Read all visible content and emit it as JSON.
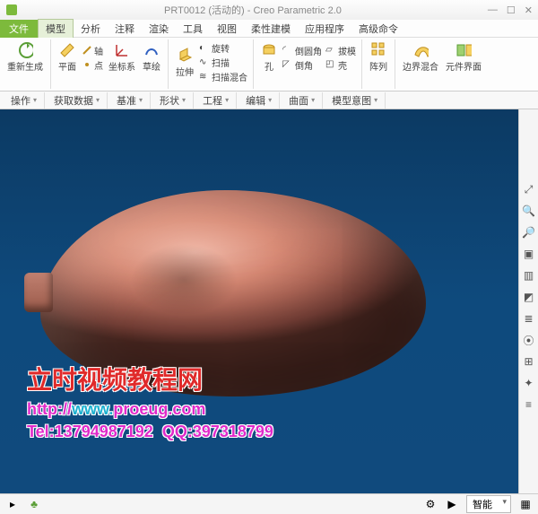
{
  "titlebar": {
    "title": "PRT0012 (活动的) - Creo Parametric 2.0"
  },
  "menubar": {
    "file": "文件",
    "items": [
      "模型",
      "分析",
      "注释",
      "渲染",
      "工具",
      "视图",
      "柔性建模",
      "应用程序",
      "高级命令"
    ],
    "active_index": 0
  },
  "ribbon": {
    "groups": [
      {
        "buttons": [
          {
            "label": "重新生成",
            "icon": "regen"
          }
        ],
        "small": [],
        "label": ""
      },
      {
        "buttons": [
          {
            "label": "平面",
            "icon": "plane"
          },
          {
            "label": "坐标系",
            "icon": "csys"
          },
          {
            "label": "草绘",
            "icon": "sketch"
          }
        ],
        "small": [
          {
            "label": "轴",
            "icon": "axis"
          },
          {
            "label": "点",
            "icon": "point"
          }
        ],
        "label": ""
      },
      {
        "buttons": [
          {
            "label": "拉伸",
            "icon": "extrude"
          }
        ],
        "small": [
          {
            "label": "旋转",
            "icon": "revolve"
          },
          {
            "label": "扫描",
            "icon": "sweep"
          },
          {
            "label": "扫描混合",
            "icon": "swblend"
          }
        ],
        "label": ""
      },
      {
        "buttons": [
          {
            "label": "孔",
            "icon": "hole"
          }
        ],
        "small": [
          {
            "label": "倒圆角",
            "icon": "round"
          },
          {
            "label": "倒角",
            "icon": "chamfer"
          }
        ],
        "small2": [
          {
            "label": "拔模",
            "icon": "draft"
          },
          {
            "label": "壳",
            "icon": "shell"
          }
        ],
        "label": ""
      },
      {
        "buttons": [
          {
            "label": "阵列",
            "icon": "pattern"
          }
        ],
        "small": [],
        "label": ""
      },
      {
        "buttons": [
          {
            "label": "边界混合",
            "icon": "boundary"
          },
          {
            "label": "元件界面",
            "icon": "component"
          }
        ],
        "small": [],
        "label": ""
      }
    ]
  },
  "subbar": {
    "items": [
      "操作",
      "获取数据",
      "基准",
      "形状",
      "工程",
      "编辑",
      "曲面",
      "模型意图"
    ]
  },
  "right_toolbar": {
    "items": [
      {
        "name": "zoom-fit-icon",
        "glyph": "⤢"
      },
      {
        "name": "zoom-in-icon",
        "glyph": "🔍"
      },
      {
        "name": "zoom-out-icon",
        "glyph": "🔎"
      },
      {
        "name": "refit-icon",
        "glyph": "▣"
      },
      {
        "name": "view-icon",
        "glyph": "▥"
      },
      {
        "name": "display-icon",
        "glyph": "◩"
      },
      {
        "name": "layers-icon",
        "glyph": "≣"
      },
      {
        "name": "snap-icon",
        "glyph": "⦿"
      },
      {
        "name": "grid-icon",
        "glyph": "⊞"
      },
      {
        "name": "coords-icon",
        "glyph": "✦"
      },
      {
        "name": "measure-icon",
        "glyph": "≡"
      }
    ]
  },
  "statusbar": {
    "combo": "智能"
  },
  "watermark": {
    "title": "立时视频教程网",
    "url_prefix": "http://",
    "url_mid": "www.",
    "url_domain": "proeug.com",
    "tel_label": "Tel:",
    "tel": "13794987192",
    "qq_label": "QQ:",
    "qq": "397318799"
  }
}
